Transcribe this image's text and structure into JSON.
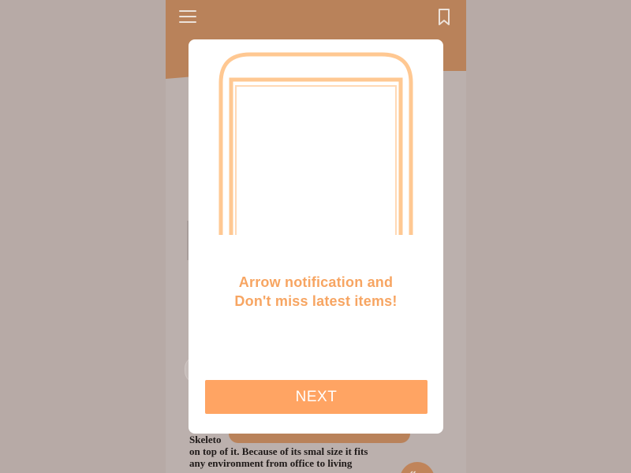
{
  "background_app": {
    "story_text_lines": [
      "Skeleto",
      "on top of it. Because of its smal size it fits",
      "any environment from office to living"
    ],
    "icons": {
      "menu": "hamburger-menu-icon",
      "bookmark": "bookmark-icon"
    },
    "header_color": "#b9825a"
  },
  "modal": {
    "illustration": "phone-outline-icon",
    "title_line1": "Arrow notification and",
    "title_line2": "Don't miss latest items!",
    "next_label": "NEXT",
    "accent_color": "#ffa463",
    "title_color": "#f7a562"
  }
}
